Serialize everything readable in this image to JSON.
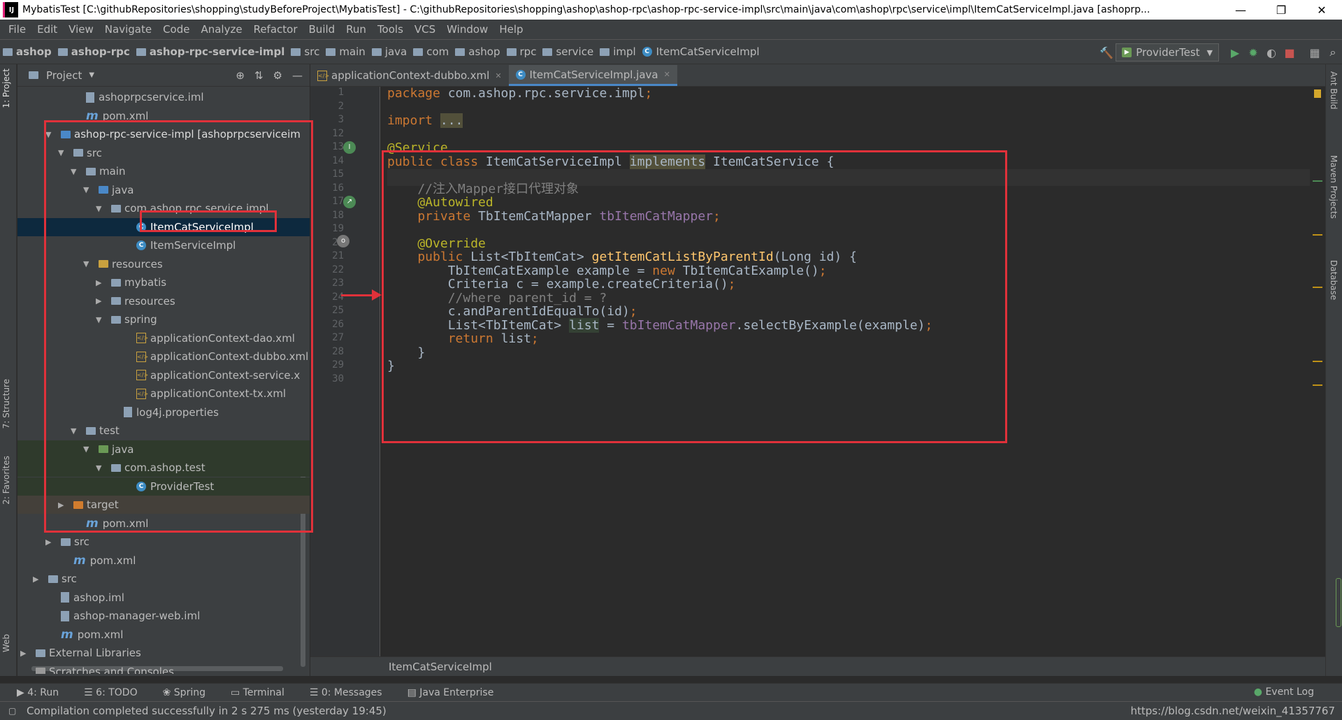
{
  "window": {
    "title": "MybatisTest [C:\\githubRepositories\\shopping\\studyBeforeProject\\MybatisTest] - C:\\githubRepositories\\shopping\\ashop\\ashop-rpc\\ashop-rpc-service-impl\\src\\main\\java\\com\\ashop\\rpc\\service\\impl\\ItemCatServiceImpl.java [ashoprp...",
    "minimize": "—",
    "restore": "❐",
    "close": "✕"
  },
  "menu": [
    "File",
    "Edit",
    "View",
    "Navigate",
    "Code",
    "Analyze",
    "Refactor",
    "Build",
    "Run",
    "Tools",
    "VCS",
    "Window",
    "Help"
  ],
  "breadcrumbs": [
    "ashop",
    "ashop-rpc",
    "ashop-rpc-service-impl",
    "src",
    "main",
    "java",
    "com",
    "ashop",
    "rpc",
    "service",
    "impl",
    "ItemCatServiceImpl"
  ],
  "run_config": "ProviderTest",
  "project_panel": {
    "title": "Project",
    "tree": [
      {
        "label": "ashoprpcservice.iml",
        "type": "iml",
        "indent": 4
      },
      {
        "label": "pom.xml",
        "type": "maven",
        "indent": 4
      },
      {
        "label": "ashop-rpc-service-impl [ashoprpcserviceim",
        "type": "module",
        "indent": 2,
        "arrow": "▼"
      },
      {
        "label": "src",
        "type": "folder",
        "indent": 3,
        "arrow": "▼"
      },
      {
        "label": "main",
        "type": "folder",
        "indent": 4,
        "arrow": "▼"
      },
      {
        "label": "java",
        "type": "folder-blue",
        "indent": 5,
        "arrow": "▼"
      },
      {
        "label": "com.ashop.rpc.service.impl",
        "type": "folder",
        "indent": 6,
        "arrow": "▼"
      },
      {
        "label": "ItemCatServiceImpl",
        "type": "class",
        "indent": 8,
        "selected": true
      },
      {
        "label": "ItemServiceImpl",
        "type": "class",
        "indent": 8
      },
      {
        "label": "resources",
        "type": "folder-yellow",
        "indent": 5,
        "arrow": "▼"
      },
      {
        "label": "mybatis",
        "type": "folder",
        "indent": 6,
        "arrow": "▶"
      },
      {
        "label": "resources",
        "type": "folder",
        "indent": 6,
        "arrow": "▶"
      },
      {
        "label": "spring",
        "type": "folder",
        "indent": 6,
        "arrow": "▼"
      },
      {
        "label": "applicationContext-dao.xml",
        "type": "xml",
        "indent": 8
      },
      {
        "label": "applicationContext-dubbo.xml",
        "type": "xml",
        "indent": 8
      },
      {
        "label": "applicationContext-service.x",
        "type": "xml",
        "indent": 8
      },
      {
        "label": "applicationContext-tx.xml",
        "type": "xml",
        "indent": 8
      },
      {
        "label": "log4j.properties",
        "type": "props",
        "indent": 7
      },
      {
        "label": "test",
        "type": "folder",
        "indent": 4,
        "arrow": "▼"
      },
      {
        "label": "java",
        "type": "folder-green",
        "indent": 5,
        "arrow": "▼",
        "test": true
      },
      {
        "label": "com.ashop.test",
        "type": "folder",
        "indent": 6,
        "arrow": "▼",
        "test": true
      },
      {
        "label": "ProviderTest",
        "type": "class",
        "indent": 8,
        "test": true
      },
      {
        "label": "target",
        "type": "folder-orange",
        "indent": 3,
        "arrow": "▶",
        "target": true
      },
      {
        "label": "pom.xml",
        "type": "maven",
        "indent": 4
      },
      {
        "label": "src",
        "type": "folder",
        "indent": 2,
        "arrow": "▶"
      },
      {
        "label": "pom.xml",
        "type": "maven",
        "indent": 3
      },
      {
        "label": "src",
        "type": "folder",
        "indent": 1,
        "arrow": "▶"
      },
      {
        "label": "ashop.iml",
        "type": "iml",
        "indent": 2
      },
      {
        "label": "ashop-manager-web.iml",
        "type": "iml",
        "indent": 2
      },
      {
        "label": "pom.xml",
        "type": "maven",
        "indent": 2
      },
      {
        "label": "External Libraries",
        "type": "libs",
        "indent": 0,
        "arrow": "▶"
      },
      {
        "label": "Scratches and Consoles",
        "type": "scratch",
        "indent": 0
      }
    ]
  },
  "editor_tabs": [
    {
      "label": "applicationContext-dubbo.xml",
      "icon": "xml",
      "active": false
    },
    {
      "label": "ItemCatServiceImpl.java",
      "icon": "class",
      "active": true
    }
  ],
  "line_numbers": [
    "1",
    "2",
    "3",
    "12",
    "13",
    "14",
    "15",
    "16",
    "17",
    "18",
    "19",
    "20",
    "21",
    "22",
    "23",
    "24",
    "25",
    "26",
    "27",
    "28",
    "29",
    "30"
  ],
  "code_lines": [
    [
      [
        "kw",
        "package "
      ],
      [
        "str",
        "com.ashop.rpc.service.impl"
      ],
      [
        "kw",
        ";"
      ]
    ],
    [],
    [
      [
        "kw",
        "import "
      ],
      [
        "hlw",
        "..."
      ]
    ],
    [],
    [
      [
        "ann",
        "@Service"
      ]
    ],
    [
      [
        "kw",
        "public class "
      ],
      [
        "str",
        "ItemCatServiceImpl "
      ],
      [
        "hlw",
        "implements"
      ],
      [
        "str",
        " ItemCatService {"
      ]
    ],
    [],
    [
      [
        "cmt",
        "    //注入Mapper接口代理对象"
      ]
    ],
    [
      [
        "str",
        "    "
      ],
      [
        "ann",
        "@Autowired"
      ]
    ],
    [
      [
        "kw",
        "    private "
      ],
      [
        "str",
        "TbItemCatMapper "
      ],
      [
        "fld",
        "tbItemCatMapper"
      ],
      [
        "kw",
        ";"
      ]
    ],
    [],
    [
      [
        "ann",
        "    @Override"
      ]
    ],
    [
      [
        "kw",
        "    public "
      ],
      [
        "str",
        "List<TbItemCat> "
      ],
      [
        "fn",
        "getItemCatListByParentId"
      ],
      [
        "str",
        "(Long id) {"
      ]
    ],
    [
      [
        "str",
        "        TbItemCatExample example = "
      ],
      [
        "kw",
        "new "
      ],
      [
        "str",
        "TbItemCatExample()"
      ],
      [
        "kw",
        ";"
      ]
    ],
    [
      [
        "str",
        "        Criteria c = example.createCriteria()"
      ],
      [
        "kw",
        ";"
      ]
    ],
    [
      [
        "cmt",
        "        //where parent_id = ?"
      ]
    ],
    [
      [
        "str",
        "        c.andParentIdEqualTo(id)"
      ],
      [
        "kw",
        ";"
      ]
    ],
    [
      [
        "str",
        "        List<TbItemCat> "
      ],
      [
        "hl",
        "list"
      ],
      [
        "str",
        " = "
      ],
      [
        "fld",
        "tbItemCatMapper"
      ],
      [
        "str",
        ".selectByExample(example)"
      ],
      [
        "kw",
        ";"
      ]
    ],
    [
      [
        "kw",
        "        return "
      ],
      [
        "str",
        "list"
      ],
      [
        "kw",
        ";"
      ]
    ],
    [
      [
        "str",
        "    }"
      ]
    ],
    [
      [
        "str",
        "}"
      ]
    ],
    []
  ],
  "editor_breadcrumb": "ItemCatServiceImpl",
  "bottom_tools": [
    "4: Run",
    "6: TODO",
    "Spring",
    "Terminal",
    "0: Messages",
    "Java Enterprise"
  ],
  "event_log": "Event Log",
  "left_tool_tabs": [
    "1: Project",
    "7: Structure",
    "2: Favorites",
    "Web"
  ],
  "right_tool_tabs": [
    "Ant Build",
    "Maven Projects",
    "Database"
  ],
  "status": {
    "message": "Compilation completed successfully in 2 s 275 ms (yesterday 19:45)",
    "right": "https://blog.csdn.net/weixin_41357767"
  },
  "colors": {
    "accent": "#4a88c7",
    "highlight_box": "#e0313a"
  }
}
